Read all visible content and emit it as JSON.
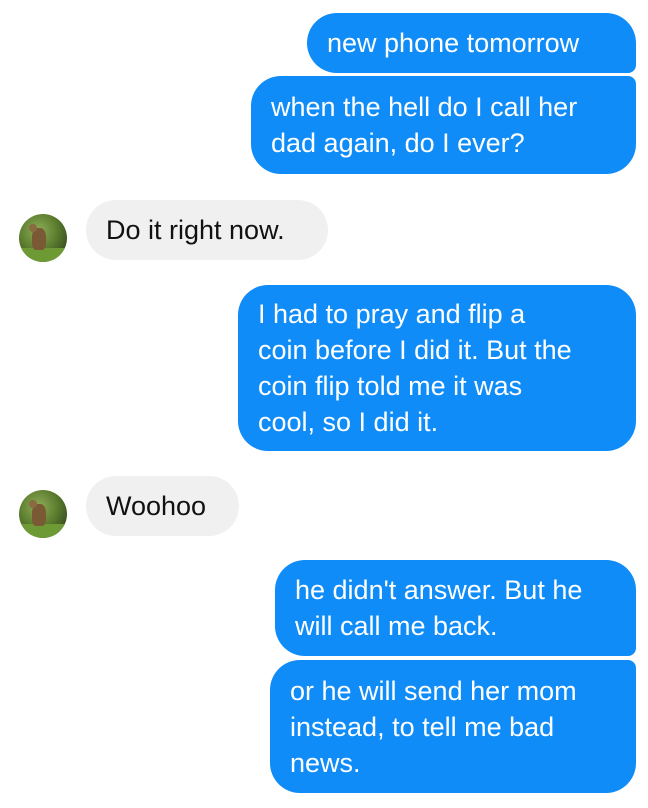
{
  "messages": [
    {
      "from": "me",
      "text": "new phone tomorrow"
    },
    {
      "from": "me",
      "text": "when the hell do I call her\ndad again, do I ever?"
    },
    {
      "from": "them",
      "text": "Do it right now."
    },
    {
      "from": "me",
      "text": "I had to pray and flip a\ncoin before I did it. But the\ncoin flip told me it was\ncool, so I did it."
    },
    {
      "from": "them",
      "text": "Woohoo"
    },
    {
      "from": "me",
      "text": "he didn't answer. But he\nwill call me back."
    },
    {
      "from": "me",
      "text": "or he will send her mom\ninstead, to tell me bad\nnews."
    }
  ],
  "contact": {
    "avatar_icon": "contact-avatar-deer-photo"
  },
  "colors": {
    "sent_bubble": "#0f8cf7",
    "received_bubble": "#f0f0f0",
    "sent_text": "#ffffff",
    "received_text": "#111111"
  }
}
